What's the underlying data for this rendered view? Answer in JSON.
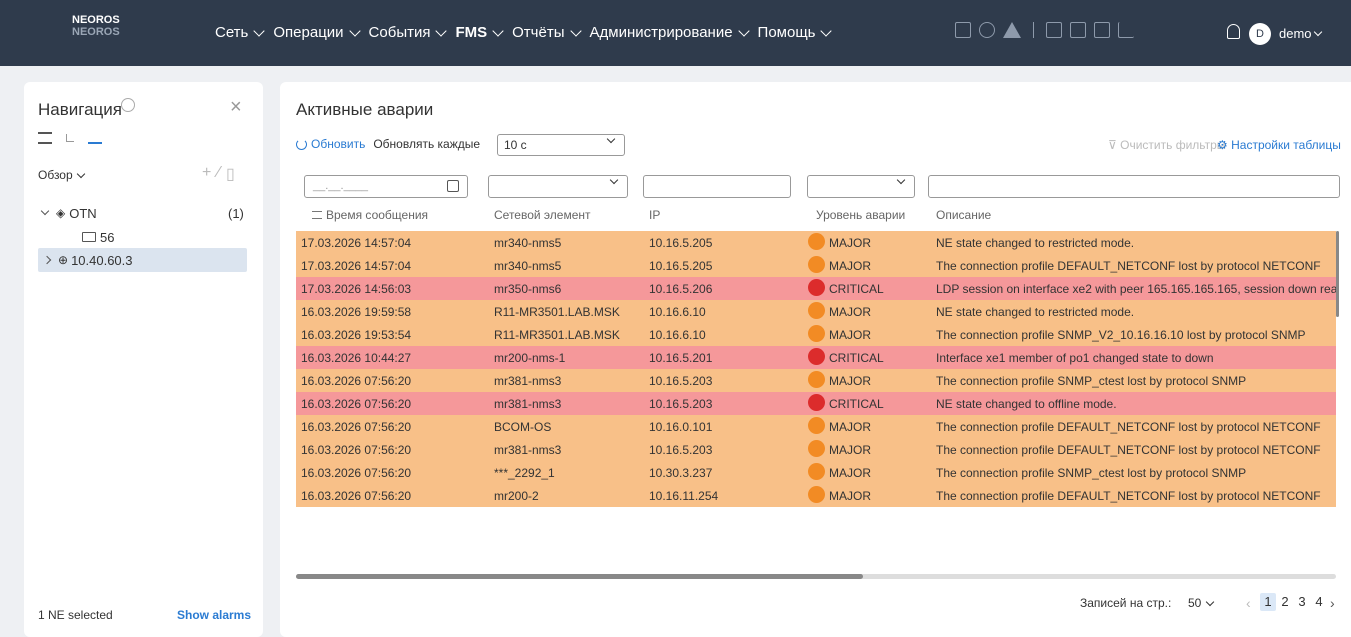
{
  "brand": {
    "name": "NEOROS",
    "sub": "NEOROS"
  },
  "menu": [
    {
      "label": "Сеть",
      "bold": false
    },
    {
      "label": "Операции",
      "bold": false
    },
    {
      "label": "События",
      "bold": false
    },
    {
      "label": "FMS",
      "bold": true
    },
    {
      "label": "Отчёты",
      "bold": false
    },
    {
      "label": "Администрирование",
      "bold": false
    },
    {
      "label": "Помощь",
      "bold": false
    }
  ],
  "user": {
    "avatar": "D",
    "name": "demo"
  },
  "nav": {
    "title": "Навигация",
    "overview": "Обзор",
    "tree": {
      "root": {
        "label": "OTN",
        "count": "(1)"
      },
      "folder": {
        "label": "56"
      },
      "device": {
        "label": "10.40.60.3"
      }
    },
    "footer": {
      "selected": "1 NE selected",
      "show_alarms": "Show alarms"
    }
  },
  "main": {
    "title": "Активные аварии",
    "refresh": "Обновить",
    "refresh_every": "Обновлять каждые",
    "interval": "10 с",
    "clear_filters": "Очистить фильтры",
    "table_settings": "Настройки таблицы",
    "date_placeholder": "__.__.____",
    "columns": {
      "time": "Время сообщения",
      "ne": "Сетевой элемент",
      "ip": "IP",
      "severity": "Уровень аварии",
      "desc": "Описание"
    }
  },
  "alarms": [
    {
      "time": "17.03.2026 14:57:04",
      "ne": "mr340-nms5",
      "ip": "10.16.5.205",
      "severity": "MAJOR",
      "desc": "NE state changed to restricted mode."
    },
    {
      "time": "17.03.2026 14:57:04",
      "ne": "mr340-nms5",
      "ip": "10.16.5.205",
      "severity": "MAJOR",
      "desc": "The connection profile DEFAULT_NETCONF lost by protocol NETCONF"
    },
    {
      "time": "17.03.2026 14:56:03",
      "ne": "mr350-nms6",
      "ip": "10.16.5.206",
      "severity": "CRITICAL",
      "desc": "LDP session on interface xe2 with peer 165.165.165.165, session down rea"
    },
    {
      "time": "16.03.2026 19:59:58",
      "ne": "R11-MR3501.LAB.MSK",
      "ip": "10.16.6.10",
      "severity": "MAJOR",
      "desc": "NE state changed to restricted mode."
    },
    {
      "time": "16.03.2026 19:53:54",
      "ne": "R11-MR3501.LAB.MSK",
      "ip": "10.16.6.10",
      "severity": "MAJOR",
      "desc": "The connection profile SNMP_V2_10.16.16.10 lost by protocol SNMP"
    },
    {
      "time": "16.03.2026 10:44:27",
      "ne": "mr200-nms-1",
      "ip": "10.16.5.201",
      "severity": "CRITICAL",
      "desc": "Interface xe1 member of po1 changed state to down"
    },
    {
      "time": "16.03.2026 07:56:20",
      "ne": "mr381-nms3",
      "ip": "10.16.5.203",
      "severity": "MAJOR",
      "desc": "The connection profile SNMP_ctest lost by protocol SNMP"
    },
    {
      "time": "16.03.2026 07:56:20",
      "ne": "mr381-nms3",
      "ip": "10.16.5.203",
      "severity": "CRITICAL",
      "desc": "NE state changed to offline mode."
    },
    {
      "time": "16.03.2026 07:56:20",
      "ne": "BCOM-OS",
      "ip": "10.16.0.101",
      "severity": "MAJOR",
      "desc": "The connection profile DEFAULT_NETCONF lost by protocol NETCONF"
    },
    {
      "time": "16.03.2026 07:56:20",
      "ne": "mr381-nms3",
      "ip": "10.16.5.203",
      "severity": "MAJOR",
      "desc": "The connection profile DEFAULT_NETCONF lost by protocol NETCONF"
    },
    {
      "time": "16.03.2026 07:56:20",
      "ne": "***_2292_1",
      "ip": "10.30.3.237",
      "severity": "MAJOR",
      "desc": "The connection profile SNMP_ctest lost by protocol SNMP"
    },
    {
      "time": "16.03.2026 07:56:20",
      "ne": "mr200-2",
      "ip": "10.16.11.254",
      "severity": "MAJOR",
      "desc": "The connection profile DEFAULT_NETCONF lost by protocol NETCONF"
    }
  ],
  "pagination": {
    "label": "Записей на стр.:",
    "per_page": "50",
    "pages": [
      "1",
      "2",
      "3",
      "4"
    ],
    "current": "1"
  }
}
